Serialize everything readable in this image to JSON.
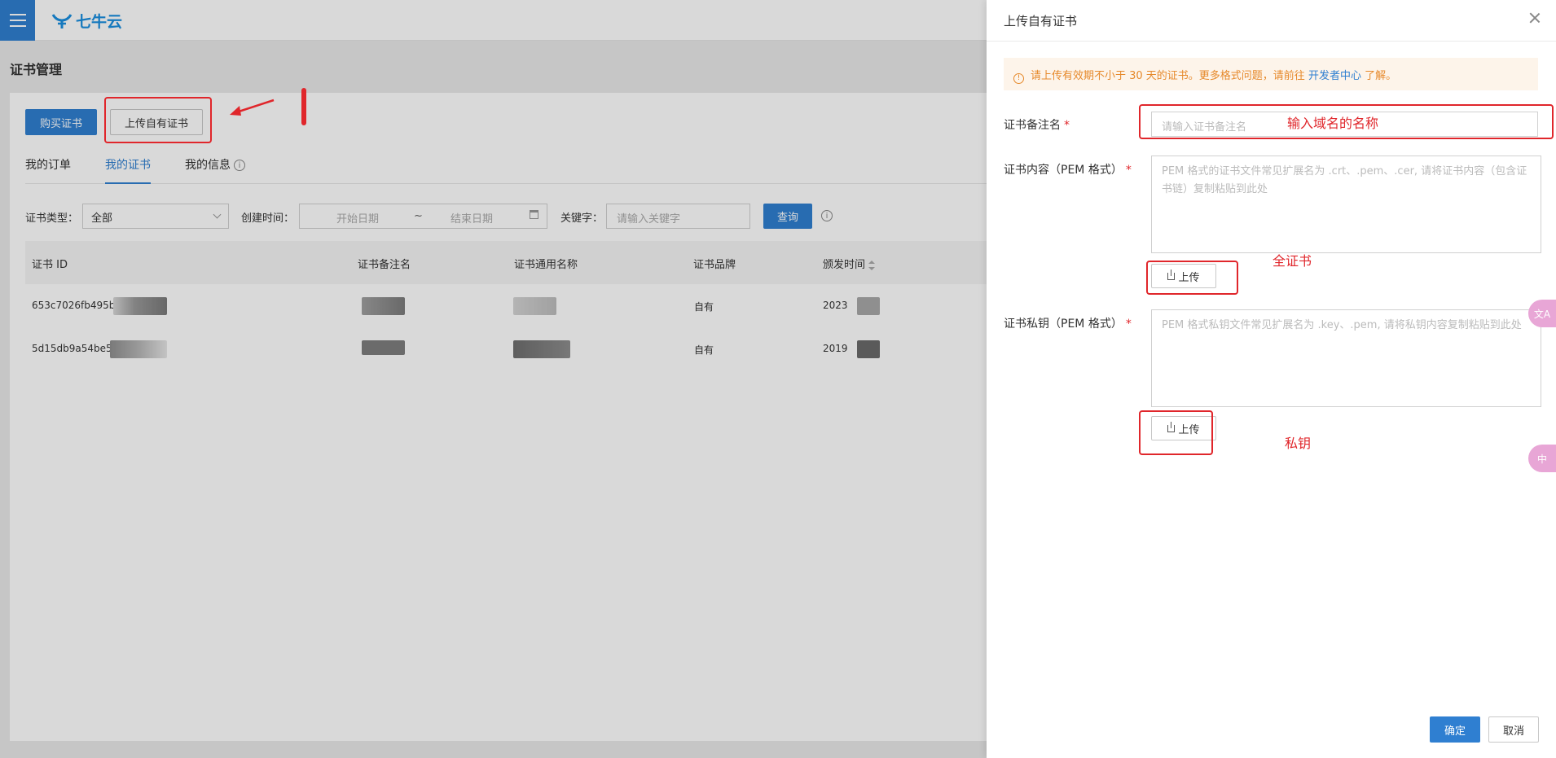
{
  "topbar": {
    "logo_text": "七牛云"
  },
  "page": {
    "title": "证书管理"
  },
  "toolbar": {
    "buy_label": "购买证书",
    "upload_label": "上传自有证书"
  },
  "tabs": [
    {
      "label": "我的订单"
    },
    {
      "label": "我的证书"
    },
    {
      "label": "我的信息"
    }
  ],
  "filters": {
    "type_label": "证书类型：",
    "type_value": "全部",
    "created_label": "创建时间：",
    "start_placeholder": "开始日期",
    "range_sep": "~",
    "end_placeholder": "结束日期",
    "keyword_label": "关键字：",
    "keyword_placeholder": "请输入关键字",
    "query_label": "查询"
  },
  "table": {
    "columns": [
      "证书 ID",
      "证书备注名",
      "证书通用名称",
      "证书品牌",
      "颁发时间"
    ],
    "rows": [
      {
        "id": "653c7026fb495b",
        "brand": "自有",
        "issued": "2023"
      },
      {
        "id": "5d15db9a54be51",
        "brand": "自有",
        "issued": "2019"
      }
    ]
  },
  "drawer": {
    "title": "上传自有证书",
    "alert_text": "请上传有效期不小于 30 天的证书。更多格式问题，请前往",
    "alert_link": "开发者中心",
    "alert_tail": "了解。",
    "name_label": "证书备注名",
    "name_placeholder": "请输入证书备注名",
    "content_label": "证书内容（PEM 格式）",
    "content_placeholder": "PEM 格式的证书文件常见扩展名为 .crt、.pem、.cer, 请将证书内容（包含证书链）复制粘贴到此处",
    "key_label": "证书私钥（PEM 格式）",
    "key_placeholder": "PEM 格式私钥文件常见扩展名为 .key、.pem, 请将私钥内容复制粘贴到此处",
    "upload_label": "上传",
    "required_mark": "*",
    "confirm_label": "确定",
    "cancel_label": "取消"
  },
  "annotations": {
    "name_hint": "输入域名的名称",
    "cert_hint": "全证书",
    "key_hint": "私钥"
  },
  "side_widgets": {
    "translate": "文A",
    "ime": "中"
  },
  "colors": {
    "accent": "#2f7fd1",
    "annotation": "#e0262b",
    "warning": "#e6892b"
  }
}
